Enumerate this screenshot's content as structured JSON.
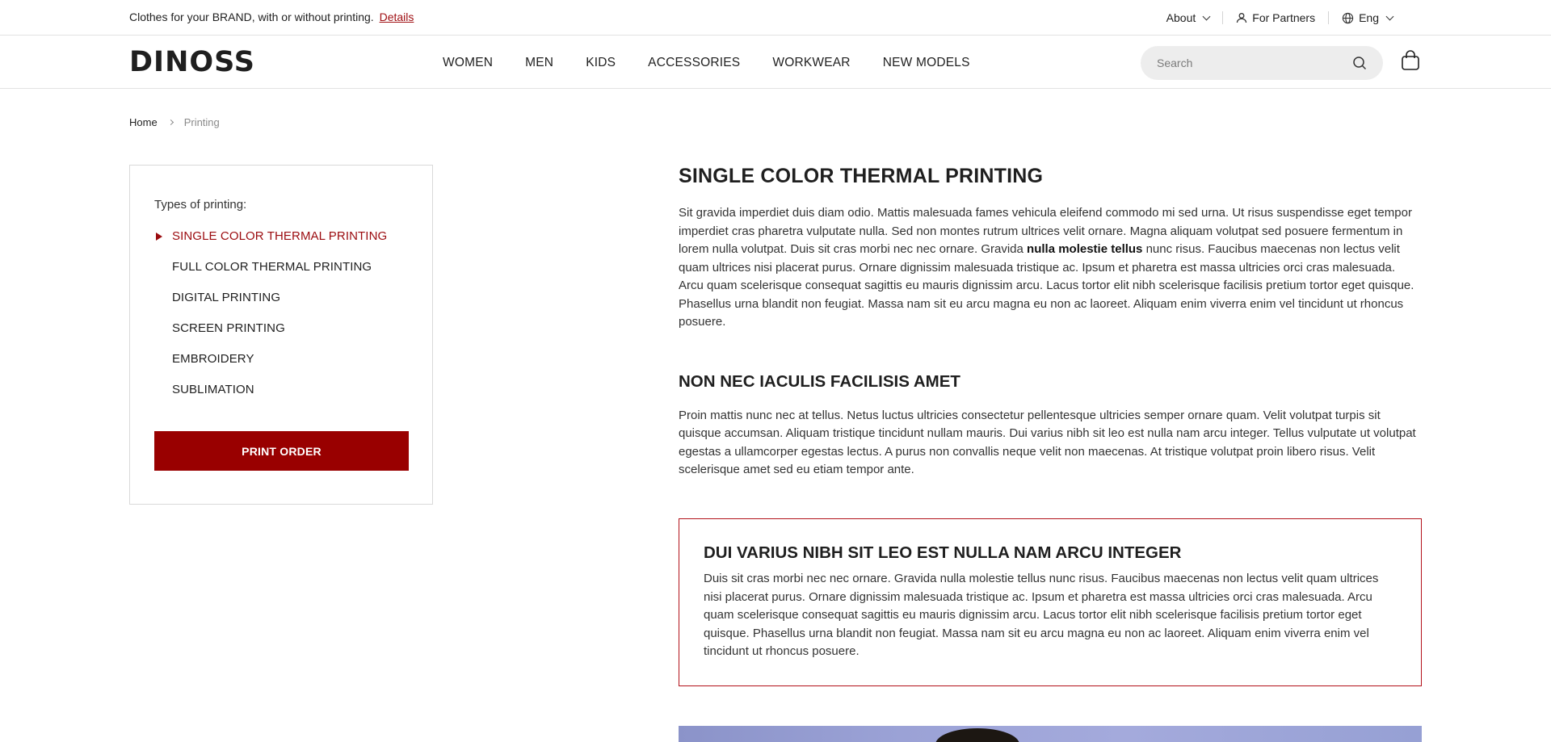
{
  "topbar": {
    "promo_text": "Clothes for your BRAND, with or without printing.",
    "promo_link": "Details",
    "about_label": "About",
    "partners_label": "For Partners",
    "lang_label": "Eng"
  },
  "header": {
    "logo_text": "DINOSS",
    "nav": [
      "WOMEN",
      "MEN",
      "KIDS",
      "ACCESSORIES",
      "WORKWEAR",
      "NEW MODELS"
    ],
    "search_placeholder": "Search"
  },
  "breadcrumb": {
    "home": "Home",
    "current": "Printing"
  },
  "sidebar": {
    "title": "Types of printing:",
    "items": [
      {
        "label": "SINGLE COLOR THERMAL PRINTING",
        "active": true
      },
      {
        "label": "FULL COLOR THERMAL PRINTING",
        "active": false
      },
      {
        "label": "DIGITAL PRINTING",
        "active": false
      },
      {
        "label": "SCREEN PRINTING",
        "active": false
      },
      {
        "label": "EMBROIDERY",
        "active": false
      },
      {
        "label": "SUBLIMATION",
        "active": false
      }
    ],
    "button_label": "PRINT ORDER"
  },
  "content": {
    "title": "SINGLE COLOR THERMAL PRINTING",
    "para1_start": "Sit gravida imperdiet duis diam odio. Mattis malesuada fames vehicula eleifend commodo mi sed urna. Ut risus suspendisse eget tempor imperdiet cras pharetra vulputate nulla. Sed non montes rutrum ultrices velit ornare. Magna aliquam volutpat sed posuere fermentum in lorem nulla volutpat. Duis sit cras morbi nec nec ornare. Gravida",
    "para1_bold": "nulla molestie tellus",
    "para1_end": "nunc risus. Faucibus maecenas non lectus velit quam ultrices nisi placerat purus. Ornare dignissim malesuada tristique ac. Ipsum et pharetra est massa ultricies orci cras malesuada. Arcu quam scelerisque consequat sagittis eu mauris dignissim arcu. Lacus tortor elit nibh scelerisque facilisis pretium tortor eget quisque. Phasellus urna blandit non feugiat. Massa nam sit eu arcu magna eu non ac laoreet. Aliquam enim viverra enim vel tincidunt ut rhoncus posuere.",
    "subtitle": "NON NEC IACULIS FACILISIS AMET",
    "para2": "Proin mattis nunc nec at tellus. Netus luctus ultricies consectetur pellentesque ultricies semper ornare quam. Velit volutpat turpis sit quisque accumsan. Aliquam tristique tincidunt nullam mauris. Dui varius nibh sit leo est nulla nam arcu integer. Tellus vulputate ut volutpat egestas a ullamcorper egestas lectus. A purus non convallis neque velit non maecenas. At tristique volutpat proin libero risus. Velit scelerisque amet sed eu etiam tempor ante.",
    "highlight_title": "DUI VARIUS NIBH SIT LEO EST NULLA NAM ARCU INTEGER",
    "highlight_text": "Duis sit cras morbi nec nec ornare. Gravida nulla molestie tellus nunc risus. Faucibus maecenas non lectus velit quam ultrices nisi placerat purus. Ornare dignissim malesuada tristique ac. Ipsum et pharetra est massa ultricies orci cras malesuada. Arcu quam scelerisque consequat sagittis eu mauris dignissim arcu. Lacus tortor elit nibh scelerisque facilisis pretium tortor eget quisque. Phasellus urna blandit non feugiat. Massa nam sit eu arcu magna eu non ac laoreet. Aliquam enim viverra enim vel tincidunt ut rhoncus posuere."
  },
  "colors": {
    "accent": "#990000",
    "active_text": "#9b0b0f",
    "highlight_border": "#b3121a"
  }
}
